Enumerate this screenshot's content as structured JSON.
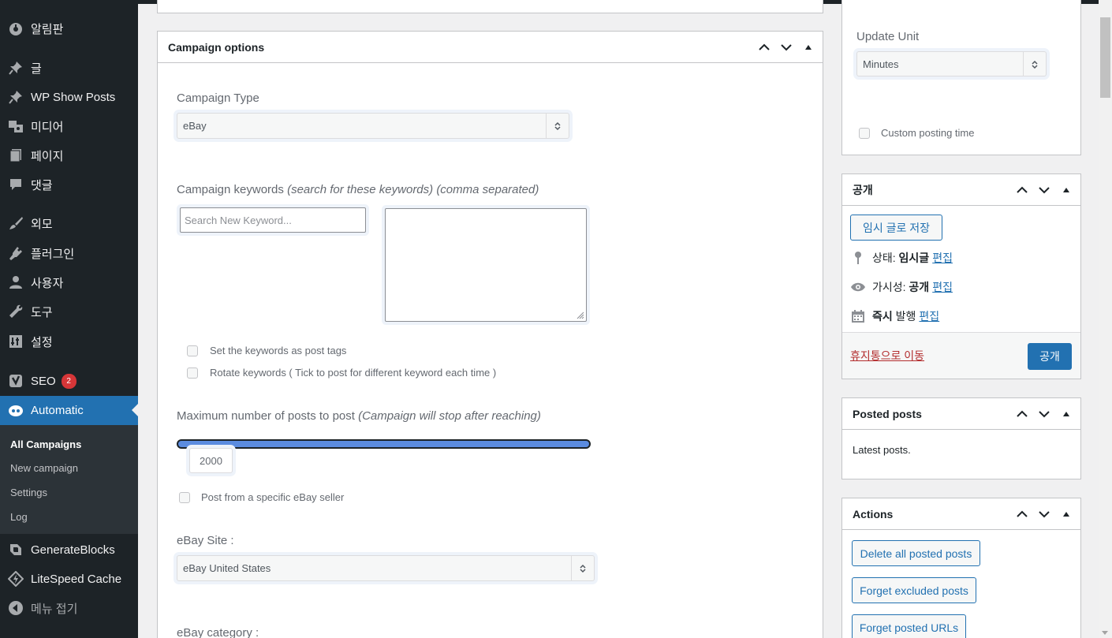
{
  "sidebar": {
    "items": [
      {
        "label": "알림판",
        "icon": "dashboard-icon"
      },
      {
        "label": "글",
        "icon": "pin-icon"
      },
      {
        "label": "WP Show Posts",
        "icon": "pin-icon"
      },
      {
        "label": "미디어",
        "icon": "media-icon"
      },
      {
        "label": "페이지",
        "icon": "page-icon"
      },
      {
        "label": "댓글",
        "icon": "comment-icon"
      },
      {
        "label": "외모",
        "icon": "brush-icon"
      },
      {
        "label": "플러그인",
        "icon": "plugin-icon"
      },
      {
        "label": "사용자",
        "icon": "user-icon"
      },
      {
        "label": "도구",
        "icon": "wrench-icon"
      },
      {
        "label": "설정",
        "icon": "settings-icon"
      },
      {
        "label": "SEO",
        "icon": "yoast-icon",
        "badge": "2"
      },
      {
        "label": "Automatic",
        "icon": "automatic-icon"
      },
      {
        "label": "GenerateBlocks",
        "icon": "generateblocks-icon"
      },
      {
        "label": "LiteSpeed Cache",
        "icon": "litespeed-icon"
      },
      {
        "label": "메뉴 접기",
        "icon": "collapse-icon"
      }
    ],
    "submenu": [
      "All Campaigns",
      "New campaign",
      "Settings",
      "Log"
    ]
  },
  "campaign_options": {
    "title": "Campaign options",
    "campaign_type_label": "Campaign Type",
    "campaign_type_value": "eBay",
    "keywords_label": "Campaign keywords",
    "keywords_hint": "(search for these keywords) (comma separated)",
    "keyword_placeholder": "Search New Keyword...",
    "cb_tags": "Set the keywords as post tags",
    "cb_rotate": "Rotate keywords ( Tick to post for different keyword each time )",
    "max_posts_label": "Maximum number of posts to post",
    "max_posts_hint": "(Campaign will stop after reaching)",
    "max_posts_value": "2000",
    "cb_seller": "Post from a specific eBay seller",
    "site_label": "eBay Site :",
    "site_value": "eBay United States",
    "category_label": "eBay category :"
  },
  "update_box": {
    "update_unit_label": "Update Unit",
    "update_unit_value": "Minutes",
    "custom_time": "Custom posting time"
  },
  "publish_box": {
    "title": "공개",
    "save_draft": "임시 글로 저장",
    "status_label": "상태:",
    "status_value": "임시글",
    "visibility_label": "가시성:",
    "visibility_value": "공개",
    "publish_label_bold": "즉시",
    "publish_label": "발행",
    "edit": "편집",
    "trash": "휴지통으로 이동",
    "publish_button": "공개"
  },
  "posted_box": {
    "title": "Posted posts",
    "text": "Latest posts."
  },
  "actions_box": {
    "title": "Actions",
    "buttons": [
      "Delete all posted posts",
      "Forget excluded posts",
      "Forget posted URLs"
    ]
  },
  "colors": {
    "sidebar_bg": "#1d2327",
    "accent": "#2271b1",
    "badge": "#d63638",
    "slider": "#5b8ce0"
  }
}
